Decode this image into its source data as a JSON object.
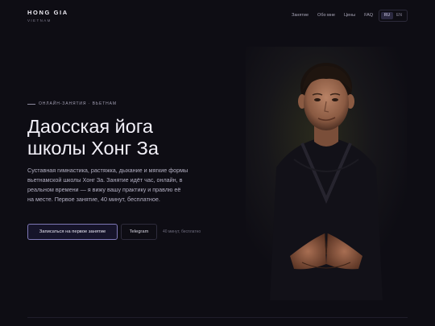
{
  "header": {
    "logo_name": "HONG GIA",
    "logo_sub": "VIETNAM",
    "nav": [
      {
        "label": "Занятие"
      },
      {
        "label": "Обо мне"
      },
      {
        "label": "Цены"
      },
      {
        "label": "FAQ"
      }
    ],
    "languages": [
      {
        "label": "RU",
        "active": true
      },
      {
        "label": "EN",
        "active": false
      }
    ]
  },
  "hero": {
    "eyebrow": "ОНЛАЙН-ЗАНЯТИЯ · ВЬЕТНАМ",
    "title_line1": "Даосская йога",
    "title_line2": "школы Хонг За",
    "description": "Суставная гимнастика, растяжка, дыхание и мягкие формы вьетнамской школы Хонг За. Занятие идёт час, онлайн, в реальном времени — я вижу вашу практику и правлю её на месте. Первое занятие, 40 минут, бесплатное.",
    "cta_label": "Записаться на первое занятие",
    "telegram_label": "Telegram",
    "cta_note": "40 минут, бесплатно"
  },
  "colors": {
    "background": "#0e0d14",
    "accent_border": "#7e78b6",
    "text_primary": "#f2f0f8",
    "text_muted": "#b4b1c4"
  },
  "icons": [
    "portrait-photo"
  ]
}
